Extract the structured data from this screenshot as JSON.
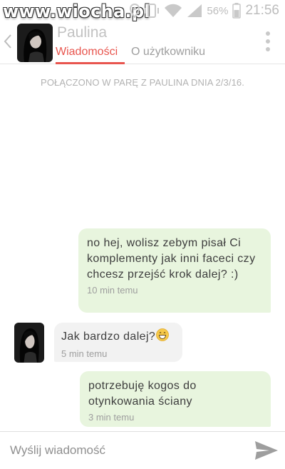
{
  "status_bar": {
    "watermark": "www.wiocha.pl",
    "battery": "56%",
    "time": "21:56",
    "icons": [
      "location-icon",
      "phone-vibrate-icon",
      "wifi-icon",
      "signal-icon",
      "battery-icon"
    ]
  },
  "header": {
    "contact_name": "Paulina",
    "tabs": [
      {
        "label": "Wiadomości",
        "active": true
      },
      {
        "label": "O użytkowniku",
        "active": false
      }
    ],
    "icons": [
      "back-chevron-icon",
      "more-vertical-icon"
    ]
  },
  "match_banner": "POŁĄCZONO W PARĘ Z PAULINA DNIA 2/3/16.",
  "messages": [
    {
      "direction": "sent",
      "text": "no hej, wolisz zebym pisał Ci komplementy jak inni faceci czy chcesz przejść krok dalej? :)",
      "time": "10 min temu"
    },
    {
      "direction": "received",
      "text": "Jak bardzo dalej?",
      "emoji": "grinning-face-icon",
      "time": "5 min temu"
    },
    {
      "direction": "sent",
      "text": "potrzebuję kogos do otynkowania ściany",
      "time": "3 min temu"
    }
  ],
  "composer": {
    "placeholder": "Wyślij wiadomość",
    "value": "",
    "send_icon": "send-icon"
  },
  "colors": {
    "accent": "#e8554e",
    "sent_bubble": "#e8f5de",
    "received_bubble": "#f2f2f2"
  }
}
